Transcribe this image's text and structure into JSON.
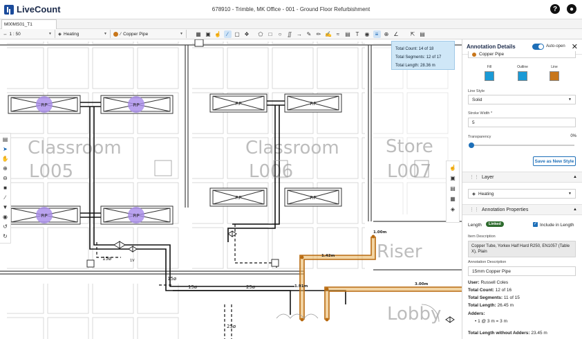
{
  "app": {
    "name": "LiveCount",
    "doc_title": "678910 - Trimble, MK Office - 001 - Ground Floor Refurbishment"
  },
  "tab": {
    "label": "M00MS01_T1"
  },
  "toolbar": {
    "scale": "1 : 50",
    "layer": "Heating",
    "style": "Copper Pipe"
  },
  "tooltip": {
    "count": "Total Count: 14 of 18",
    "segments": "Total Segments: 12 of 17",
    "length": "Total Length: 28.36 m"
  },
  "drawing": {
    "rooms": [
      "Classroom",
      "L005",
      "Classroom",
      "L006",
      "Store",
      "L007",
      "Riser",
      "Lobby"
    ],
    "rp": "RP",
    "dims": [
      "15ø",
      "15ø",
      "25ø",
      "25ø",
      "15ø"
    ],
    "meas": [
      "1.00m",
      "1.42m",
      "1.91m",
      "3.00m"
    ],
    "valve_label": "1V"
  },
  "panel": {
    "title": "Annotation Details",
    "auto_open": "Auto-open",
    "style_name": "Copper Pipe",
    "fill_label": "Fill",
    "outline_label": "Outline",
    "line_label": "Line",
    "fill_color": "#1a9ad6",
    "outline_color": "#1a9ad6",
    "line_color": "#c8761a",
    "line_style_label": "Line Style",
    "line_style": "Solid",
    "stroke_label": "Stroke Width *",
    "stroke": "5",
    "transparency_label": "Transparency",
    "transparency": "0%",
    "save_style": "Save as New Style",
    "layer_section": "Layer",
    "layer": "Heating",
    "props_section": "Annotation Properties",
    "length_label": "Length",
    "linked": "Linked",
    "include": "Include in Length",
    "item_desc_label": "Item Description",
    "item_desc": "Copper Tube, Yorkex Half Hard R250, EN1057 (Table X), Plain",
    "annot_desc_label": "Annotation Description",
    "annot_desc": "15mm Copper Pipe",
    "user_k": "User:",
    "user_v": "Russell Coles",
    "count_k": "Total Count:",
    "count_v": "12 of 16",
    "seg_k": "Total Segments:",
    "seg_v": "11 of 15",
    "len_k": "Total Length:",
    "len_v": "26.45 m",
    "adders_k": "Adders:",
    "adders_v": "1 @ 3 m = 3 m",
    "lwo_k": "Total Length without Adders:",
    "lwo_v": "23.45 m"
  },
  "colors": {
    "accent": "#1d6fb8",
    "pipe": "#c8761a",
    "rp_highlight": "#a78bea"
  }
}
